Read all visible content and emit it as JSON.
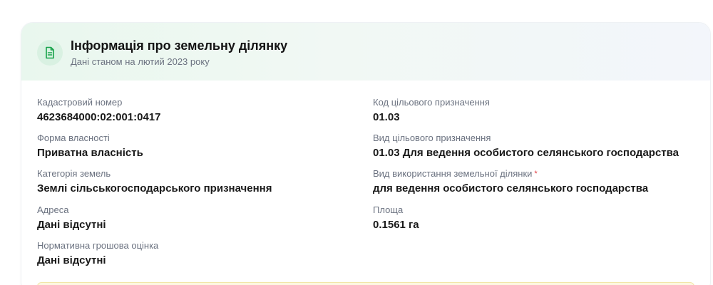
{
  "header": {
    "icon": "document-icon",
    "title": "Інформація про земельну ділянку",
    "subtitle": "Дані станом на лютий 2023 року"
  },
  "left_column": [
    {
      "label": "Кадастровий номер",
      "value": "4623684000:02:001:0417"
    },
    {
      "label": "Форма власності",
      "value": "Приватна власність"
    },
    {
      "label": "Категорія земель",
      "value": "Землі сільськогосподарського призначення"
    },
    {
      "label": "Адреса",
      "value": "Дані відсутні"
    },
    {
      "label": "Нормативна грошова оцінка",
      "value": "Дані відсутні"
    }
  ],
  "right_column": [
    {
      "label": "Код цільового призначення",
      "value": "01.03"
    },
    {
      "label": "Вид цільового призначення",
      "value": "01.03 Для ведення особистого селянського господарства"
    },
    {
      "label": "Вид використання земельної ділянки",
      "required_mark": "*",
      "value": "для ведення особистого селянського господарства"
    },
    {
      "label": "Площа",
      "value": "0.1561 га"
    }
  ],
  "colors": {
    "accent_green": "#17a34a",
    "icon_bg": "#d9f1e2",
    "required": "#e0383e",
    "notice_bg": "#fdf8e1"
  }
}
